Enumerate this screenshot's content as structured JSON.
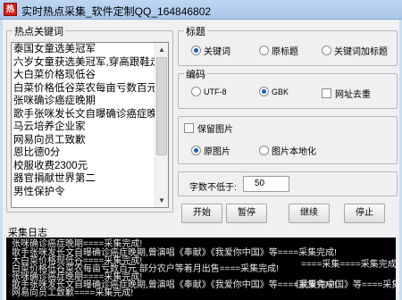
{
  "window": {
    "title": "实时热点采集_软件定制QQ_164846802",
    "icon_text": "热"
  },
  "hot_keywords": {
    "label": "热点关键词",
    "items": [
      "泰国女童选美冠军",
      "六岁女童获选美冠军,穿高跟鞋走T台显",
      "大白菜价格现低谷",
      "白菜价格低谷菜农每亩亏数百元 部分",
      "张咪确诊癌症晚期",
      "歌手张咪发长文自曝确诊癌症晚期,曾演",
      "马云培养企业家",
      "网易向员工致歉",
      "恩比德0分",
      "校服收费2300元",
      "器官捐献世界第二",
      "男性保护令"
    ]
  },
  "title_group": {
    "label": "标题",
    "options": [
      "关键词",
      "原标题",
      "关键词加标题"
    ],
    "selected": "关键词"
  },
  "encoding_group": {
    "label": "编码",
    "options": [
      "UTF-8",
      "GBK"
    ],
    "selected": "GBK",
    "dedupe_label": "网址去重"
  },
  "image_group": {
    "keep_images_label": "保留图片",
    "options": [
      "原图片",
      "图片本地化"
    ],
    "selected": "原图片"
  },
  "min_chars": {
    "label": "字数不低于:",
    "value": "50"
  },
  "buttons": {
    "start": "开始",
    "pause": "暂停",
    "continue": "继续",
    "stop": "停止"
  },
  "log": {
    "label": "采集日志",
    "lines": [
      "张咪确诊癌症晚期====采集完成!",
      "歌手张咪发长文自曝确诊癌症晚期,曾演唱《奉献》《我爱你中国》等====采集完成!",
      "大白菜价格现低谷====采集完成!",
      "白菜价格低谷菜农每亩亏数百元 部分农户等着月出售====采集完成!",
      "张咪确诊癌症晚期====采集完成!",
      "歌手张咪发长文自曝确诊癌症晚期,曾演唱《奉献》《我爱你中国》等====采集完成!",
      "网易向员工致歉====采集完成!"
    ],
    "right_lines": [
      "====采集====采集完成",
      "《我爱你中国》等====采集完成"
    ]
  },
  "colors": {
    "log_bg": "#000000",
    "log_text": "#e6e6e6",
    "radio_dot": "#1b5fb8",
    "window_frame": "#c9def5"
  }
}
